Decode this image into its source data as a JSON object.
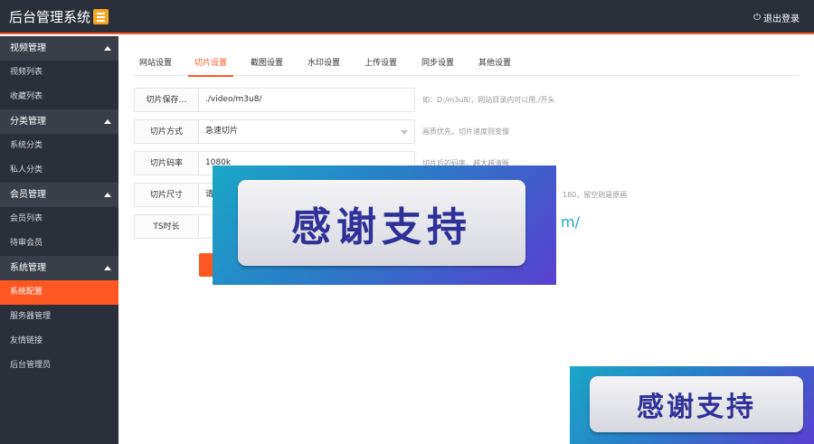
{
  "header": {
    "title": "后台管理系统",
    "menu_icon": "menu-icon",
    "logout_label": "退出登录",
    "logout_icon": "power-icon",
    "accent_color": "#ff5722",
    "bg_color": "#2b2f3a"
  },
  "sidebar": {
    "groups": [
      {
        "title": "视频管理",
        "items": [
          {
            "label": "视频列表"
          },
          {
            "label": "收藏列表"
          }
        ]
      },
      {
        "title": "分类管理",
        "items": [
          {
            "label": "系统分类"
          },
          {
            "label": "私人分类"
          }
        ]
      },
      {
        "title": "会员管理",
        "items": [
          {
            "label": "会员列表"
          },
          {
            "label": "待审会员"
          }
        ]
      },
      {
        "title": "系统管理",
        "items": [
          {
            "label": "系统配置",
            "active": true
          },
          {
            "label": "服务器管理"
          },
          {
            "label": "友情链接"
          },
          {
            "label": "后台管理员"
          }
        ]
      }
    ]
  },
  "tabs": [
    {
      "label": "网站设置"
    },
    {
      "label": "切片设置",
      "active": true
    },
    {
      "label": "截图设置"
    },
    {
      "label": "水印设置"
    },
    {
      "label": "上传设置"
    },
    {
      "label": "同步设置"
    },
    {
      "label": "其他设置"
    }
  ],
  "form": {
    "rows": [
      {
        "label": "切片保存…",
        "value": "./video/m3u8/",
        "hint": "如：D:/m3u8/，网站目录内可以用./开头"
      },
      {
        "label": "切片方式",
        "value": "急速切片",
        "hint": "画质优先，切片速度则变慢"
      },
      {
        "label": "切片码率",
        "value": "1080k",
        "hint": "切片后的码率，越大越清晰"
      },
      {
        "label": "切片尺寸",
        "value": "请",
        "hint": "180，留空则是原画"
      },
      {
        "label": "TS时长",
        "value": "",
        "hint": ""
      }
    ]
  },
  "overlay": {
    "banner_text": "感谢支持",
    "url_fragment": "m/"
  }
}
